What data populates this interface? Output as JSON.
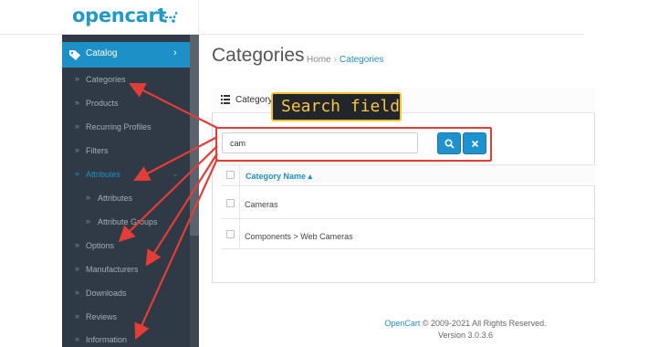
{
  "header": {
    "logo_text": "opencart",
    "logo_icon": "cart-icon",
    "brand_color": "#229ac8"
  },
  "sidebar": {
    "active_menu": {
      "label": "Catalog",
      "icon": "tag-icon"
    },
    "items": [
      {
        "label": "Categories"
      },
      {
        "label": "Products"
      },
      {
        "label": "Recurring Profiles"
      },
      {
        "label": "Filters"
      },
      {
        "label": "Attributes"
      },
      {
        "label": "Attributes"
      },
      {
        "label": "Attribute Groups"
      },
      {
        "label": "Options"
      },
      {
        "label": "Manufacturers"
      },
      {
        "label": "Downloads"
      },
      {
        "label": "Reviews"
      },
      {
        "label": "Information"
      }
    ],
    "accent_color": "#1e90c8"
  },
  "page": {
    "title": "Categories",
    "breadcrumb": {
      "home": "Home",
      "separator": "›",
      "current": "Categories"
    }
  },
  "panel": {
    "title": "Category List",
    "search": {
      "value": "cam"
    },
    "search_icon": "search-icon",
    "clear_icon": "close-icon",
    "table": {
      "header": "Category Name ▴",
      "rows": [
        {
          "name": "Cameras"
        },
        {
          "name": "Components  >  Web Cameras"
        }
      ]
    }
  },
  "footer": {
    "brand": "OpenCart",
    "copyright": "© 2009-2021 All Rights Reserved.",
    "version": "Version 3.0.3.6"
  },
  "annotation": {
    "callout_label": "Search field",
    "callout_color": "#f6c543",
    "arrow_color": "#e23d36"
  }
}
